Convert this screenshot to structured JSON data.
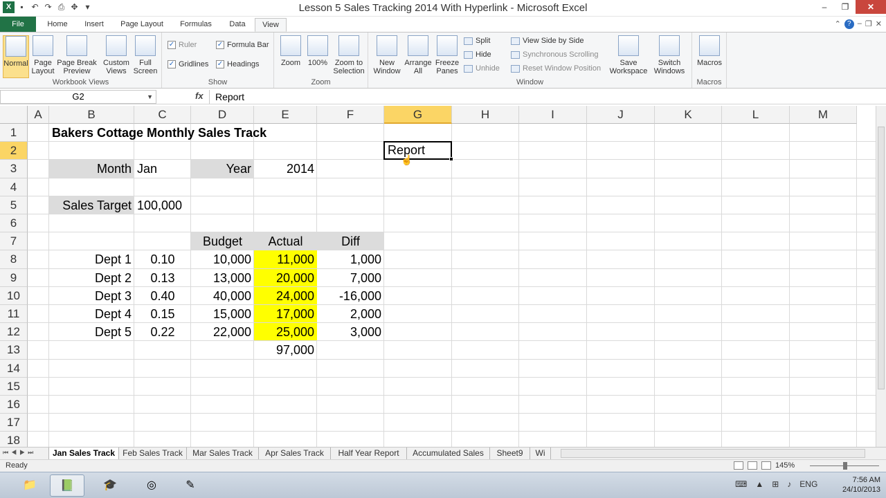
{
  "window": {
    "title": "Lesson 5 Sales Tracking 2014 With Hyperlink - Microsoft Excel"
  },
  "tabs": [
    "File",
    "Home",
    "Insert",
    "Page Layout",
    "Formulas",
    "Data",
    "View"
  ],
  "ribbon": {
    "workbook_views": {
      "label": "Workbook Views",
      "buttons": [
        "Normal",
        "Page Layout",
        "Page Break Preview",
        "Custom Views",
        "Full Screen"
      ]
    },
    "show": {
      "label": "Show",
      "ruler": "Ruler",
      "formula_bar": "Formula Bar",
      "gridlines": "Gridlines",
      "headings": "Headings"
    },
    "zoom": {
      "label": "Zoom",
      "buttons": [
        "Zoom",
        "100%",
        "Zoom to Selection"
      ]
    },
    "window": {
      "label": "Window",
      "new_window": "New Window",
      "arrange_all": "Arrange All",
      "freeze_panes": "Freeze Panes",
      "split": "Split",
      "hide": "Hide",
      "unhide": "Unhide",
      "view_side_by_side": "View Side by Side",
      "synchronous_scrolling": "Synchronous Scrolling",
      "reset_window_position": "Reset Window Position",
      "save_workspace": "Save Workspace",
      "switch_windows": "Switch Windows"
    },
    "macros": {
      "label": "Macros",
      "button": "Macros"
    }
  },
  "formula_bar": {
    "name_box": "G2",
    "fx": "fx",
    "content": "Report"
  },
  "columns": [
    "A",
    "B",
    "C",
    "D",
    "E",
    "F",
    "G",
    "H",
    "I",
    "J",
    "K",
    "L",
    "M"
  ],
  "rows": [
    "1",
    "2",
    "3",
    "4",
    "5",
    "6",
    "7",
    "8",
    "9",
    "10",
    "11",
    "12",
    "13",
    "14",
    "15",
    "16",
    "17",
    "18"
  ],
  "cells": {
    "title": "Bakers Cottage Monthly Sales Track",
    "report_link": "Report",
    "month_label": "Month",
    "month_value": "Jan",
    "year_label": "Year",
    "year_value": "2014",
    "sales_target_label": "Sales Target",
    "sales_target_value": "100,000",
    "hdr_budget": "Budget",
    "hdr_actual": "Actual",
    "hdr_diff": "Diff",
    "depts": [
      {
        "name": "Dept 1",
        "share": "0.10",
        "budget": "10,000",
        "actual": "11,000",
        "diff": "1,000"
      },
      {
        "name": "Dept 2",
        "share": "0.13",
        "budget": "13,000",
        "actual": "20,000",
        "diff": "7,000"
      },
      {
        "name": "Dept 3",
        "share": "0.40",
        "budget": "40,000",
        "actual": "24,000",
        "diff": "-16,000"
      },
      {
        "name": "Dept 4",
        "share": "0.15",
        "budget": "15,000",
        "actual": "17,000",
        "diff": "2,000"
      },
      {
        "name": "Dept 5",
        "share": "0.22",
        "budget": "22,000",
        "actual": "25,000",
        "diff": "3,000"
      }
    ],
    "actual_total": "97,000"
  },
  "sheet_tabs": [
    "Jan Sales Track",
    "Feb Sales Track",
    "Mar Sales Track",
    "Apr Sales Track",
    "Half Year Report",
    "Accumulated Sales",
    "Sheet9",
    "Wi"
  ],
  "status": {
    "ready": "Ready",
    "zoom": "145%"
  },
  "taskbar": {
    "time": "7:56 AM",
    "date": "24/10/2013",
    "lang": "ENG"
  },
  "colors": {
    "highlight": "#ffff00",
    "label_fill": "#dcdcdc",
    "excel_green": "#217346",
    "selected_header": "#fbd565"
  }
}
